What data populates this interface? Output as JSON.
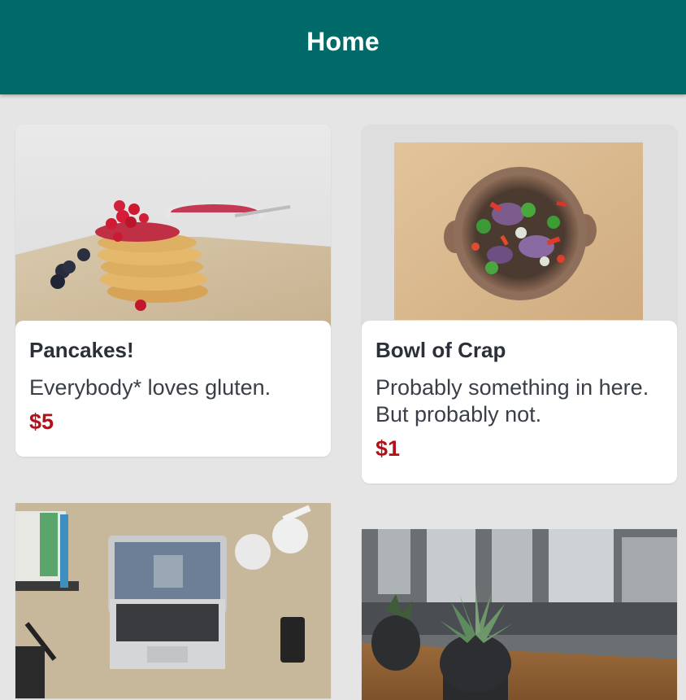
{
  "header": {
    "title": "Home"
  },
  "colors": {
    "app_bar": "#006a68",
    "background": "#e5e5e5",
    "price": "#b3111a",
    "title_text": "#2b3038"
  },
  "items": [
    {
      "title": "Pancakes!",
      "description": "Everybody* loves gluten.",
      "price": "$5",
      "image": "pancakes-photo"
    },
    {
      "title": "Bowl of Crap",
      "description": "Probably something in here. But probably not.",
      "price": "$1",
      "image": "salad-bowl-photo"
    },
    {
      "image": "laptop-desk-photo"
    },
    {
      "image": "potted-plant-photo"
    }
  ]
}
